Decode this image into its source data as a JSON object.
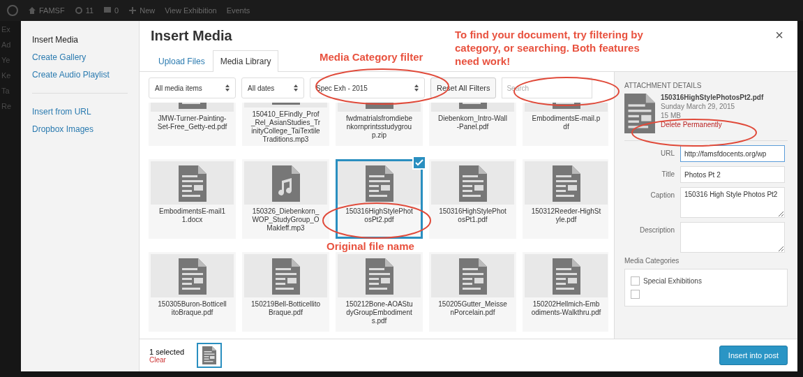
{
  "admin_bar": {
    "site": "FAMSF",
    "updates": "11",
    "comments": "0",
    "new": "New",
    "links": [
      "View Exhibition",
      "Events"
    ]
  },
  "admin_menu": [
    "Ex",
    "Ad",
    "Ye",
    "Ke",
    "Ta",
    "Re"
  ],
  "sidebar": {
    "items": [
      {
        "label": "Insert Media",
        "selected": true
      },
      {
        "label": "Create Gallery",
        "selected": false
      },
      {
        "label": "Create Audio Playlist",
        "selected": false
      }
    ],
    "extra_items": [
      "Insert from URL",
      "Dropbox Images"
    ]
  },
  "title": "Insert Media",
  "close": "×",
  "tabs": [
    {
      "label": "Upload Files",
      "selected": false
    },
    {
      "label": "Media Library",
      "selected": true
    }
  ],
  "toolbar": {
    "type_filter": "All media items",
    "date_filter": "All dates",
    "category_filter": "Spec Exh - 2015",
    "reset": "Reset All Filters",
    "search_placeholder": "Search"
  },
  "tiles": [
    {
      "name": "JMW-Turner-Painting-Set-Free_Getty-ed.pdf",
      "kind": "document",
      "selected": false
    },
    {
      "name": "150410_EFindly_Prof_Rel_AsianStudies_TrinityCollege_TaiTextileTraditions.mp3",
      "kind": "audio",
      "selected": false
    },
    {
      "name": "fwdmatrialsfromdiebenkornprintsstudygroup.zip",
      "kind": "archive",
      "selected": false
    },
    {
      "name": "Diebenkorn_Intro-Wall-Panel.pdf",
      "kind": "document",
      "selected": false
    },
    {
      "name": "EmbodimentsE-mail.pdf",
      "kind": "document",
      "selected": false
    },
    {
      "name": "EmbodimentsE-mail11.docx",
      "kind": "document",
      "selected": false
    },
    {
      "name": "150326_Diebenkorn_WOP_StudyGroup_OMakleff.mp3",
      "kind": "audio",
      "selected": false
    },
    {
      "name": "150316HighStylePhotosPt2.pdf",
      "kind": "document",
      "selected": true
    },
    {
      "name": "150316HighStylePhotosPt1.pdf",
      "kind": "document",
      "selected": false
    },
    {
      "name": "150312Reeder-HighStyle.pdf",
      "kind": "document",
      "selected": false
    },
    {
      "name": "150305Buron-BotticellitoBraque.pdf",
      "kind": "document",
      "selected": false
    },
    {
      "name": "150219Bell-BotticellitoBraque.pdf",
      "kind": "document",
      "selected": false
    },
    {
      "name": "150212Bone-AOAStudyGroupEmbodiments.pdf",
      "kind": "document",
      "selected": false
    },
    {
      "name": "150205Gutter_MeissenPorcelain.pdf",
      "kind": "document",
      "selected": false
    },
    {
      "name": "150202Hellmich-Embodiments-Walkthru.pdf",
      "kind": "document",
      "selected": false
    }
  ],
  "details": {
    "heading": "ATTACHMENT DETAILS",
    "filename": "150316HighStylePhotosPt2.pdf",
    "date": "Sunday March 29, 2015",
    "size": "15 MB",
    "delete": "Delete Permanently",
    "fields": [
      {
        "label": "URL",
        "value": "http://famsfdocents.org/wp",
        "kind": "input"
      },
      {
        "label": "Title",
        "value": "Photos Pt 2",
        "kind": "input"
      },
      {
        "label": "Caption",
        "value": "150316 High Style Photos Pt2",
        "kind": "textarea"
      },
      {
        "label": "Description",
        "kind": "textarea"
      }
    ],
    "categories_heading": "Media Categories",
    "categories": [
      {
        "label": "Special Exhibitions",
        "checked": false
      },
      {
        "checked": false
      }
    ]
  },
  "footer": {
    "count": "1 selected",
    "clear": "Clear",
    "insert": "Insert into post"
  },
  "annotations": [
    {
      "text": "Media Category filter"
    },
    {
      "text": "To find your document, try filtering by category, or searching. Both features need work!"
    },
    {
      "text": "Original file name"
    }
  ]
}
